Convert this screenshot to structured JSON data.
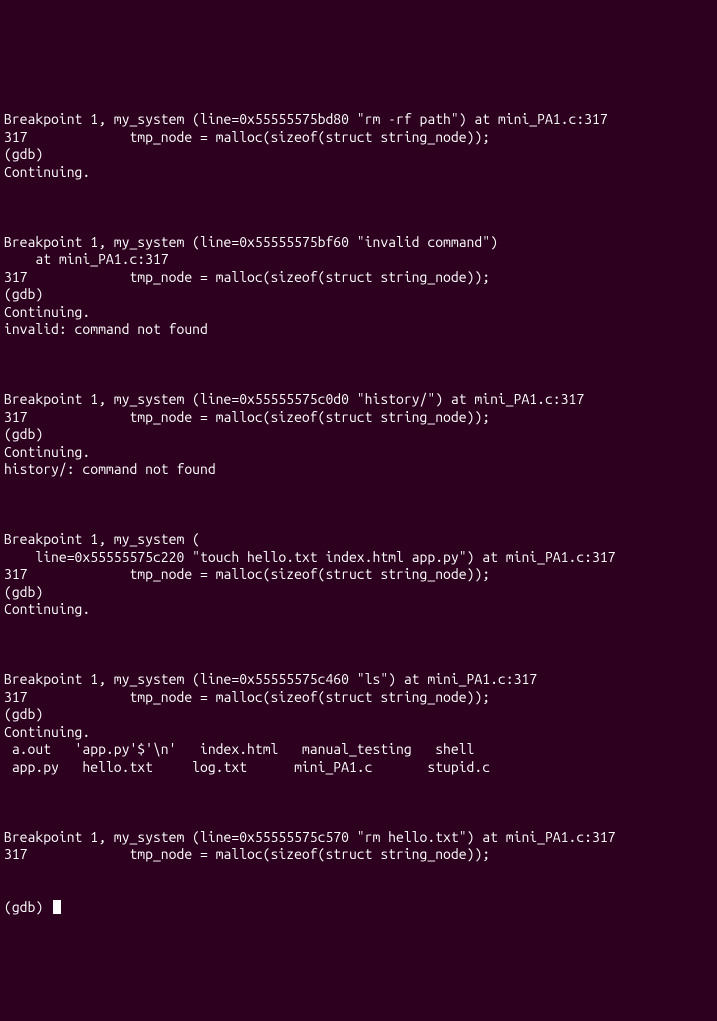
{
  "blocks": [
    {
      "lines": [
        "Breakpoint 1, my_system (line=0x55555575bd80 \"rm -rf path\") at mini_PA1.c:317",
        "317             tmp_node = malloc(sizeof(struct string_node));",
        "(gdb)",
        "Continuing."
      ]
    },
    {
      "lines": [
        "",
        "Breakpoint 1, my_system (line=0x55555575bf60 \"invalid command\")",
        "    at mini_PA1.c:317",
        "317             tmp_node = malloc(sizeof(struct string_node));",
        "(gdb)",
        "Continuing.",
        "invalid: command not found"
      ]
    },
    {
      "lines": [
        "",
        "Breakpoint 1, my_system (line=0x55555575c0d0 \"history/\") at mini_PA1.c:317",
        "317             tmp_node = malloc(sizeof(struct string_node));",
        "(gdb)",
        "Continuing.",
        "history/: command not found"
      ]
    },
    {
      "lines": [
        "",
        "Breakpoint 1, my_system (",
        "    line=0x55555575c220 \"touch hello.txt index.html app.py\") at mini_PA1.c:317",
        "317             tmp_node = malloc(sizeof(struct string_node));",
        "(gdb)",
        "Continuing."
      ]
    },
    {
      "lines": [
        "",
        "Breakpoint 1, my_system (line=0x55555575c460 \"ls\") at mini_PA1.c:317",
        "317             tmp_node = malloc(sizeof(struct string_node));",
        "(gdb)",
        "Continuing.",
        " a.out   'app.py'$'\\n'   index.html   manual_testing   shell",
        " app.py   hello.txt     log.txt      mini_PA1.c       stupid.c"
      ]
    },
    {
      "lines": [
        "",
        "Breakpoint 1, my_system (line=0x55555575c570 \"rm hello.txt\") at mini_PA1.c:317",
        "317             tmp_node = malloc(sizeof(struct string_node));"
      ]
    }
  ],
  "prompt": "(gdb) "
}
